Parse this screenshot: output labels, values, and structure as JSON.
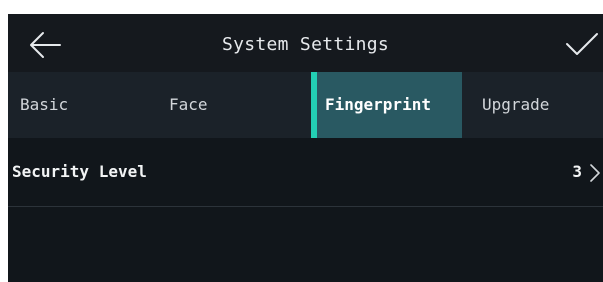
{
  "header": {
    "title": "System Settings",
    "back_icon": "arrow-left-icon",
    "confirm_icon": "checkmark-icon"
  },
  "tabs": [
    {
      "label": "Basic",
      "active": false
    },
    {
      "label": "Face",
      "active": false
    },
    {
      "label": "Fingerprint",
      "active": true
    },
    {
      "label": "Upgrade",
      "active": false
    }
  ],
  "settings": {
    "security_level": {
      "label": "Security Level",
      "value": "3",
      "icon": "chevron-right-icon"
    }
  },
  "colors": {
    "background": "#11161b",
    "tab_bar": "#1b2229",
    "active_tab": "#295962",
    "accent": "#23cfb4",
    "text": "#f2f4f5"
  }
}
